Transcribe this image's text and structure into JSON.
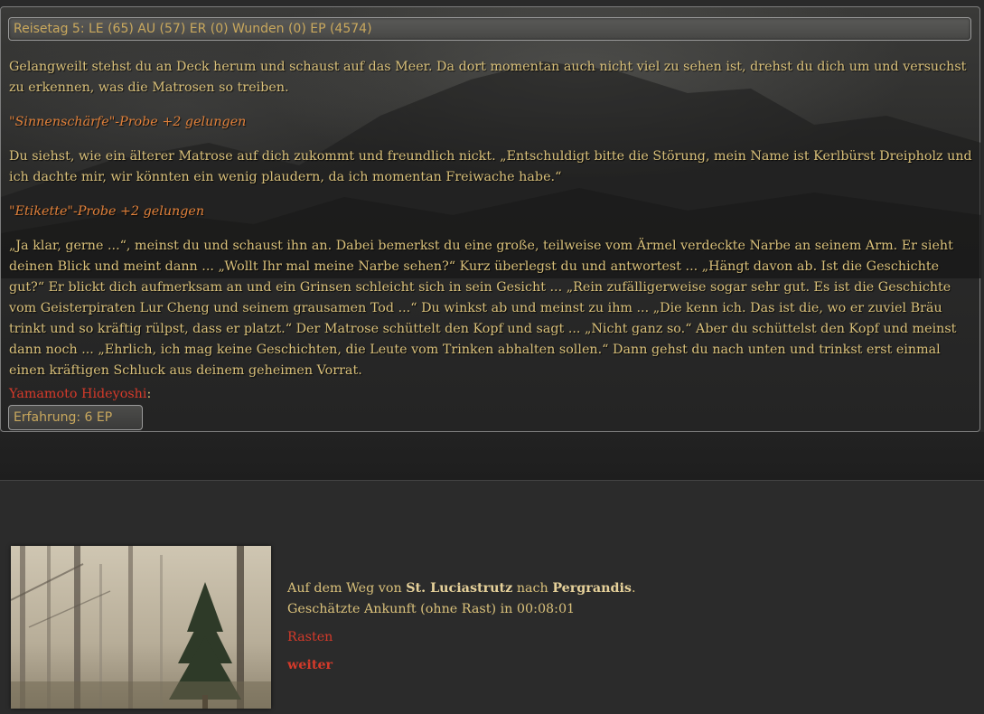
{
  "status": {
    "text": "Reisetag 5: LE (65) AU (57) ER (0) Wunden (0) EP (4574)"
  },
  "story": {
    "p1": "Gelangweilt stehst du an Deck herum und schaust auf das Meer. Da dort momentan auch nicht viel zu sehen ist, drehst du dich um und versuchst zu erkennen, was die Matrosen so treiben.",
    "probe1": "\"Sinnenschärfe\"-Probe +2 gelungen",
    "p2": "Du siehst, wie ein älterer Matrose auf dich zukommt und freundlich nickt. „Entschuldigt bitte die Störung, mein Name ist Kerlbürst Dreipholz und ich dachte mir, wir könnten ein wenig plaudern, da ich momentan Freiwache habe.“",
    "probe2": "\"Etikette\"-Probe +2 gelungen",
    "p3": "„Ja klar, gerne ...“, meinst du und schaust ihn an. Dabei bemerkst du eine große, teilweise vom Ärmel verdeckte Narbe an seinem Arm. Er sieht deinen Blick und meint dann ... „Wollt Ihr mal meine Narbe sehen?“ Kurz überlegst du und antwortest ... „Hängt davon ab. Ist die Geschichte gut?“ Er blickt dich aufmerksam an und ein Grinsen schleicht sich in sein Gesicht ... „Rein zufälligerweise sogar sehr gut. Es ist die Geschichte vom Geisterpiraten Lur Cheng und seinem grausamen Tod ...“ Du winkst ab und meinst zu ihm ... „Die kenn ich. Das ist die, wo er zuviel Bräu trinkt und so kräftig rülpst, dass er platzt.“ Der Matrose schüttelt den Kopf und sagt ... „Nicht ganz so.“ Aber du schüttelst den Kopf und meinst dann noch ... „Ehrlich, ich mag keine Geschichten, die Leute vom Trinken abhalten sollen.“ Dann gehst du nach unten und trinkst erst einmal einen kräftigen Schluck aus deinem geheimen Vorrat."
  },
  "player": {
    "name": "Yamamoto Hideyoshi",
    "colon": ":",
    "xp": "Erfahrung: 6 EP"
  },
  "travel": {
    "route_prefix": "Auf dem Weg von",
    "from": "St. Luciastrutz",
    "route_middle": "nach",
    "to": "Pergrandis",
    "route_suffix": ".",
    "eta": "Geschätzte Ankunft (ohne Rast) in 00:08:01",
    "rest_label": "Rasten",
    "continue_label": "weiter"
  },
  "colors": {
    "text": "#d9c07a",
    "probe": "#e0803a",
    "link": "#d43a2a",
    "background": "#2a2a2a"
  }
}
